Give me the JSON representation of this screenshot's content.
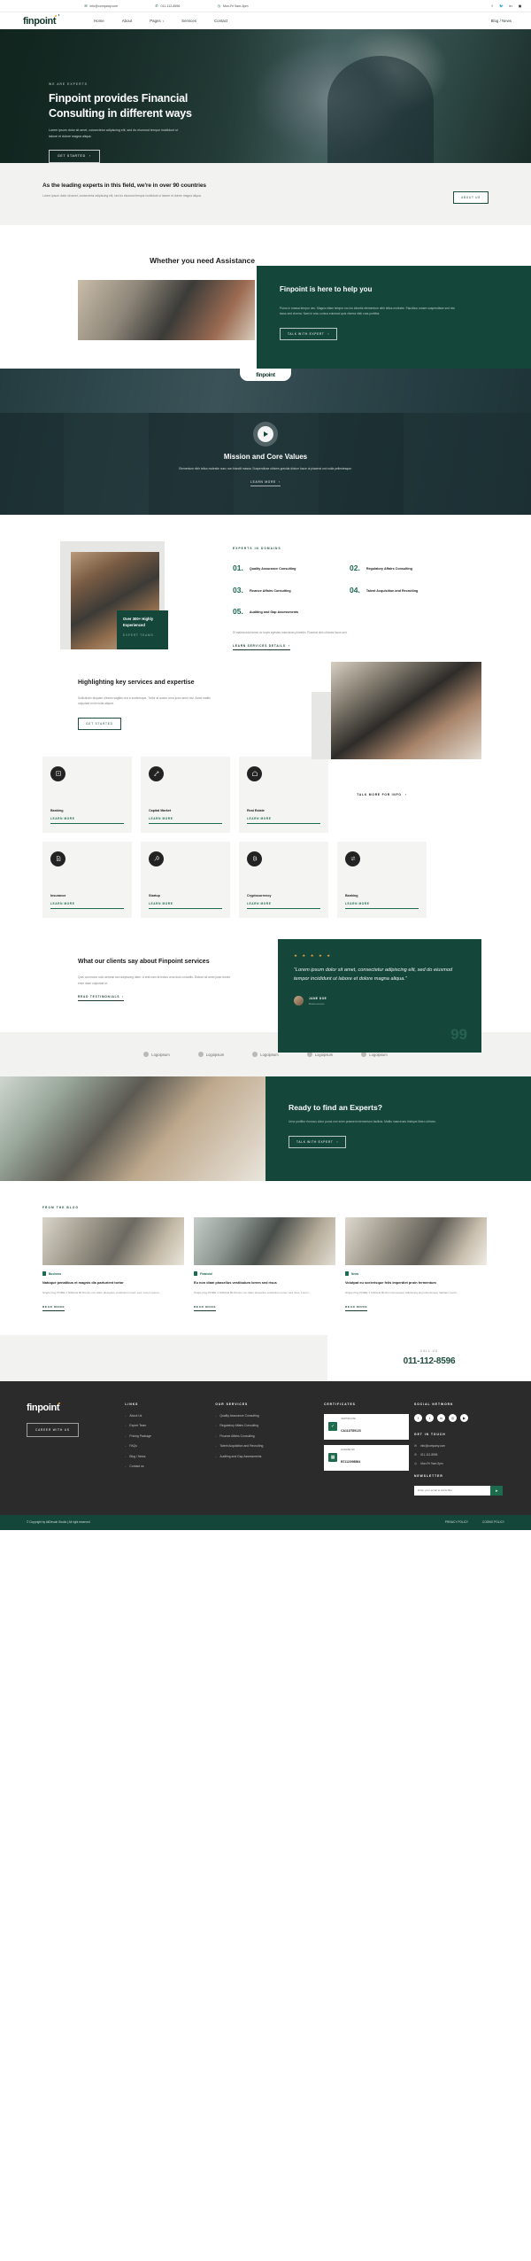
{
  "topbar": {
    "email": "info@company.com",
    "phone": "011-112-8596",
    "hours": "Mon-Fri 9am-5pm",
    "socials": [
      "facebook-icon",
      "twitter-icon",
      "linkedin-icon",
      "instagram-icon"
    ]
  },
  "nav": {
    "brand": "finpoint",
    "links": [
      "Home",
      "About",
      "Pages",
      "Services",
      "Contact"
    ],
    "right_link": "Blog / News"
  },
  "hero": {
    "eyebrow": "WE ARE EXPERTS",
    "title": "Finpoint provides Financial Consulting in different ways",
    "body": "Lorem ipsum dolor sit amet, consectetur adipiscing elit, sed do eiusmod tempor incididunt ut labore et dolore magna aliqua.",
    "cta": "GET STARTED"
  },
  "band": {
    "heading": "As the leading experts in this field, we're in over 90 countries",
    "body": "Lorem ipsum dolor sit amet, consectetur adipiscing elit, sed do eiusmod tempor incididunt ut labore et dolore magna aliqua.",
    "cta": "ABOUT US"
  },
  "assist": {
    "heading": "Whether you need Assistance",
    "card_title": "Finpoint is here to help you",
    "card_body": "Purus in massa tempor nec. Magna etiam tempor orci eu lobortis elementum nibh tellus molestie. Faucibus ornare suspendisse sed nisi lacus sed viverra. Nam in arcu cursus euismod quis viverra nibh cras porttitor.",
    "cta": "TALK WITH EXPERT"
  },
  "video": {
    "badge": "finpoint",
    "title": "Mission and Core Values",
    "body": "Elementum nibh tellus molestie nunc non blandit massa. Suspendisse ultrices gravida dictum fusce ut placerat orci nulla pellentesque.",
    "cta": "LEARN MORE"
  },
  "domains": {
    "eyebrow": "EXPERTS IN DOMAINS",
    "items": [
      {
        "num": "01.",
        "label": "Quality Assurance Consulting"
      },
      {
        "num": "02.",
        "label": "Regulatory Affairs Consulting"
      },
      {
        "num": "03.",
        "label": "Finance Affairs Consulting"
      },
      {
        "num": "04.",
        "label": "Talent Acquisition and Recruiting"
      },
      {
        "num": "05.",
        "label": "Auditing and Gap Assessments"
      }
    ],
    "foot": "Et malesuada fames ac turpis egestas maecenas pharetra. Placerat duis ultricies lacus sed.",
    "cta": "LEARN SERVICES DETAILS",
    "badge_title": "Over 300+ Highly Experienced",
    "badge_sub": "EXPERT TEAMS"
  },
  "highlight": {
    "heading": "Highlighting key services and expertise",
    "body": "Sollicitudin aliquam ultrices sagittis orci a scelerisque. Tortor at auctor urna justo amet nisi. Amet mattis vulputate enim nulla aliquet.",
    "cta": "GET STARTED"
  },
  "cards": {
    "row1": [
      {
        "title": "Banking",
        "link": "LEARN MORE",
        "icon": "bank-icon"
      },
      {
        "title": "Capital Market",
        "link": "LEARN MORE",
        "icon": "chart-up-icon"
      },
      {
        "title": "Real Estate",
        "link": "LEARN MORE",
        "icon": "house-icon"
      }
    ],
    "row2": [
      {
        "title": "Insurance",
        "link": "LEARN MORE",
        "icon": "shield-doc-icon"
      },
      {
        "title": "Startup",
        "link": "LEARN MORE",
        "icon": "rocket-icon"
      },
      {
        "title": "Cryptocurrency",
        "link": "LEARN MORE",
        "icon": "bitcoin-icon"
      },
      {
        "title": "Banking",
        "link": "LEARN MORE",
        "icon": "transfer-icon"
      }
    ],
    "more": "TALK MORE FOR INFO"
  },
  "testimonial": {
    "heading": "What our clients say about Finpoint services",
    "body": "Quis commodo odio aenean sed adipiscing diam. A erat nam at lectus urna duis convallis. Dictum sit amet justo donec enim diam vulputate ut.",
    "cta": "READ TESTIMONIALS",
    "stars": "★ ★ ★ ★ ★",
    "quote": "Lorem ipsum dolor sit amet, consectetur adipiscing elit, sed do eiusmod tempor incididunt ut labore et dolore magna aliqua.",
    "author": "JANE DOE",
    "role": "Businessman",
    "mark": "99"
  },
  "logos": [
    "Logoipsum",
    "Logoipsum",
    "Logoipsum",
    "Logoipsum",
    "Logoipsum"
  ],
  "cta": {
    "heading": "Ready to find an Experts?",
    "body": "Urna porttitor rhoncus dolor purus non enim praesent elementum facilisis. Mattis maecenas tristique libero ultrices.",
    "button": "TALK WITH EXPERT"
  },
  "blog": {
    "eyebrow": "FROM THE BLOG",
    "posts": [
      {
        "tag": "Business",
        "title": "Natoque penatibus et magnis dis parturient tortor",
        "desc": "Single blog HOME 1 SINGLE BLOG Eu non diam phasellus vestibulum lorem sed. Lorem ipsum...",
        "more": "READ MORE"
      },
      {
        "tag": "Financial",
        "title": "Eu non diam phasellus vestibulum lorem sed risus",
        "desc": "Single blog HOME 1 SINGLE BLOG Eu non diam phasellus vestibulum lorem sed risus. Lorem...",
        "more": "READ MORE"
      },
      {
        "tag": "News",
        "title": "Volutpat eu scelerisque felis imperdiet proin fermentum",
        "desc": "Single blog HOME 1 SINGLE BLOG Consectetur adipiscing elit pellentesque habitant morbi...",
        "more": "READ MORE"
      }
    ]
  },
  "phone_band": {
    "label": "CALL US",
    "number": "011-112-8596"
  },
  "footer": {
    "brand": "finpoint",
    "career_btn": "CAREER WITH US",
    "links_heading": "LINKS",
    "links": [
      "About Us",
      "Expert Team",
      "Pricing Package",
      "FAQs",
      "Blog / News",
      "Contact us"
    ],
    "services_heading": "OUR SERVICES",
    "services": [
      "Quality Assurance Consulting",
      "Regulatory Affairs Consulting",
      "Finance Affairs Consulting",
      "Talent Acquisition and Recruiting",
      "Auditing and Gap Assessments"
    ],
    "cert_heading": "CERTIFICATES",
    "certs": [
      {
        "label": "CERTIFICATE",
        "code": "CA112/789123"
      },
      {
        "label": "LICENSE NO",
        "code": "B7112/098564"
      }
    ],
    "social_heading": "SOCIAL NETWORK",
    "socials": [
      "facebook-icon",
      "twitter-icon",
      "linkedin-icon",
      "instagram-icon",
      "youtube-icon"
    ],
    "touch_heading": "GET IN TOUCH",
    "contacts": [
      {
        "icon": "mail-icon",
        "text": "info@company.com"
      },
      {
        "icon": "phone-icon",
        "text": "011-112-8596"
      },
      {
        "icon": "clock-icon",
        "text": "Mon-Fri 9am-5pm"
      }
    ],
    "newsletter_heading": "NEWSLETTER",
    "newsletter_placeholder": "Enter your email to subscribe",
    "newsletter_btn": "send-icon",
    "copyright": "© Copyright by AliDevain Studio | All right reserved",
    "bottom_links": [
      "PRIVACY POLICY",
      "COOKIE POLICY"
    ]
  },
  "colors": {
    "brand_green": "#14463a",
    "accent_green": "#1d6b4f",
    "gold": "#e8a33d",
    "dark": "#2b2b2b"
  }
}
